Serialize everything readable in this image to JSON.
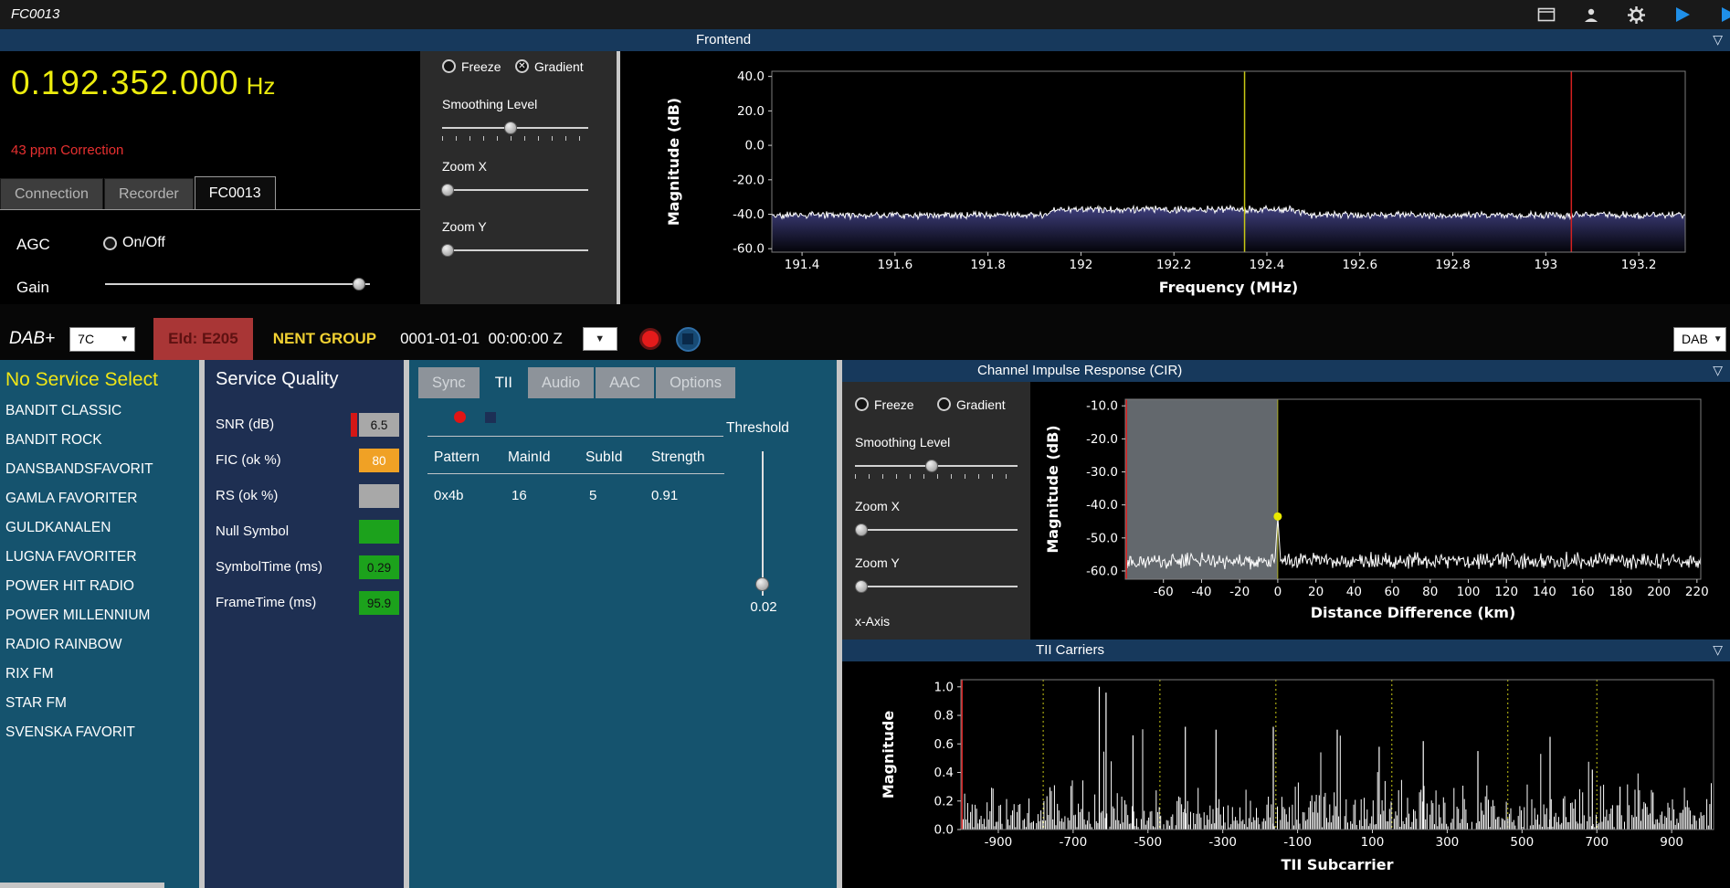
{
  "titlebar": {
    "title": "FC0013"
  },
  "frontend": {
    "header": "Frontend",
    "frequency": "0.192.352.000",
    "frequency_unit": "Hz",
    "correction": "43 ppm Correction",
    "tabs": [
      "Connection",
      "Recorder",
      "FC0013"
    ],
    "active_tab": "FC0013",
    "agc_label": "AGC",
    "agc_option": "On/Off",
    "gain_label": "Gain",
    "display_controls": {
      "freeze": "Freeze",
      "gradient": "Gradient",
      "smoothing": "Smoothing Level",
      "zoom_x": "Zoom X",
      "zoom_y": "Zoom Y"
    }
  },
  "dab_bar": {
    "mode": "DAB+",
    "channel": "7C",
    "ensemble_id": "EId: E205",
    "ensemble_name": "NENT GROUP",
    "timestamp": "0001-01-01  00:00:00 Z",
    "output_mode": "DAB"
  },
  "service_list": {
    "placeholder": "No Service Select",
    "items": [
      "BANDIT CLASSIC",
      "BANDIT ROCK",
      "DANSBANDSFAVORIT",
      "GAMLA FAVORITER",
      "GULDKANALEN",
      "LUGNA FAVORITER",
      "POWER HIT RADIO",
      "POWER MILLENNIUM",
      "RADIO RAINBOW",
      "RIX FM",
      "STAR FM",
      "SVENSKA FAVORIT"
    ]
  },
  "service_quality": {
    "title": "Service Quality",
    "rows": [
      {
        "label": "SNR (dB)",
        "value": "6.5",
        "box_color": "#a8a8a8",
        "text_color": "#101010",
        "tag_color": "#d41717"
      },
      {
        "label": "FIC (ok %)",
        "value": "80",
        "box_color": "#f0a125",
        "text_color": "#ffffff"
      },
      {
        "label": "RS (ok %)",
        "value": "",
        "box_color": "#a8a8a8",
        "text_color": "#101010"
      },
      {
        "label": "Null Symbol",
        "value": "",
        "box_color": "#1ca21c",
        "text_color": "#101010"
      },
      {
        "label": "SymbolTime (ms)",
        "value": "0.29",
        "box_color": "#1ca21c",
        "text_color": "#101010"
      },
      {
        "label": "FrameTime (ms)",
        "value": "95.9",
        "box_color": "#1ca21c",
        "text_color": "#101010"
      }
    ]
  },
  "signal_tabs": {
    "tabs": [
      "Sync",
      "TII",
      "Audio",
      "AAC",
      "Options"
    ],
    "active_tab": "TII"
  },
  "tii_tab": {
    "table_headers": [
      "Pattern",
      "MainId",
      "SubId",
      "Strength"
    ],
    "table_rows": [
      [
        "0x4b",
        "16",
        "5",
        "0.91"
      ]
    ],
    "threshold_label": "Threshold",
    "threshold_value": "0.02"
  },
  "cir_section": {
    "header": "Channel Impulse Response (CIR)",
    "controls": {
      "freeze": "Freeze",
      "gradient": "Gradient",
      "smoothing": "Smoothing Level",
      "zoom_x": "Zoom X",
      "zoom_y": "Zoom Y",
      "x_axis": "x-Axis"
    }
  },
  "tii_section": {
    "header": "TII Carriers"
  },
  "chart_data": [
    {
      "id": "spectrum",
      "type": "line",
      "title": "Frontend spectrum",
      "xlabel": "Frequency (MHz)",
      "ylabel": "Magnitude (dB)",
      "xlim": [
        191.335,
        193.3
      ],
      "ylim": [
        -62,
        43
      ],
      "xticks": [
        191.4,
        191.6,
        191.8,
        192.0,
        192.2,
        192.4,
        192.6,
        192.8,
        193.0,
        193.2
      ],
      "xtick_labels": [
        "191.4",
        "191.6",
        "191.8",
        "192",
        "192.2",
        "192.4",
        "192.6",
        "192.8",
        "193",
        "193.2"
      ],
      "yticks": [
        40,
        20,
        0,
        -20,
        -40,
        -60
      ],
      "ytick_labels": [
        "40.0",
        "20.0",
        "0.0",
        "-20.0",
        "-40.0",
        "-60.0"
      ],
      "noise_floor_db": -40.5,
      "noise_amplitude_db": 2.4,
      "dab_band": {
        "from": 191.95,
        "to": 192.45,
        "rise_db": 3.2
      },
      "markers": [
        {
          "x": 192.352,
          "color": "#c8c814",
          "name": "tuned-frequency-marker"
        },
        {
          "x": 193.055,
          "color": "#d42020",
          "name": "band-edge-marker"
        }
      ],
      "trace_color": "#ffffff",
      "fill_gradient": [
        "#3c3c78",
        "#04040a"
      ]
    },
    {
      "id": "cir",
      "type": "line",
      "title": "Channel Impulse Response (CIR)",
      "xlabel": "Distance Difference (km)",
      "ylabel": "Magnitude (dB)",
      "xlim": [
        -80,
        222
      ],
      "ylim": [
        -62.5,
        -8
      ],
      "xticks": [
        -60,
        -40,
        -20,
        0,
        20,
        40,
        60,
        80,
        100,
        120,
        140,
        160,
        180,
        200,
        220
      ],
      "yticks": [
        -10,
        -20,
        -30,
        -40,
        -50,
        -60
      ],
      "ytick_labels": [
        "-10.0",
        "-20.0",
        "-30.0",
        "-40.0",
        "-50.0",
        "-60.0"
      ],
      "noise_floor_db": -57,
      "noise_amplitude_db": 3.0,
      "main_peak": {
        "x": 0,
        "y": -43.5
      },
      "guard_region": {
        "from": -80,
        "to": 0,
        "color": "#63686d"
      },
      "zero_line_color": "#c8c814",
      "left_edge_color": "#d42020",
      "peak_dot_color": "#e8e800",
      "trace_color": "#ffffff"
    },
    {
      "id": "tii",
      "type": "bar",
      "title": "TII Carriers",
      "xlabel": "TII Subcarrier",
      "ylabel": "Magnitude",
      "xlim": [
        -1000,
        1012
      ],
      "ylim": [
        0,
        1.05
      ],
      "xticks": [
        -900,
        -700,
        -500,
        -300,
        -100,
        100,
        300,
        500,
        700,
        900
      ],
      "yticks": [
        1.0,
        0.8,
        0.6,
        0.4,
        0.2,
        0.0
      ],
      "ytick_labels": [
        "1.0",
        "0.8",
        "0.6",
        "0.4",
        "0.2",
        "0.0"
      ],
      "main_peaks": [
        {
          "x": -630,
          "h": 1.0
        },
        {
          "x": -612,
          "h": 0.96
        },
        {
          "x": -540,
          "h": 0.66
        },
        {
          "x": -400,
          "h": 0.72
        },
        {
          "x": -318,
          "h": 0.7
        },
        {
          "x": -165,
          "h": 0.72
        },
        {
          "x": 6,
          "h": 0.7
        },
        {
          "x": 118,
          "h": 0.58
        },
        {
          "x": 236,
          "h": 0.62
        },
        {
          "x": 382,
          "h": 0.55
        },
        {
          "x": 575,
          "h": 0.65
        },
        {
          "x": 688,
          "h": 0.42
        },
        {
          "x": 762,
          "h": 0.3
        },
        {
          "x": 850,
          "h": 0.26
        }
      ],
      "noise_max": 0.35,
      "dotted_lines_x": [
        -780,
        -468,
        -158,
        152,
        462,
        700
      ],
      "dotted_line_color": "#c8c814",
      "left_edge_color": "#d42020",
      "bar_color": "#ffffff"
    }
  ]
}
